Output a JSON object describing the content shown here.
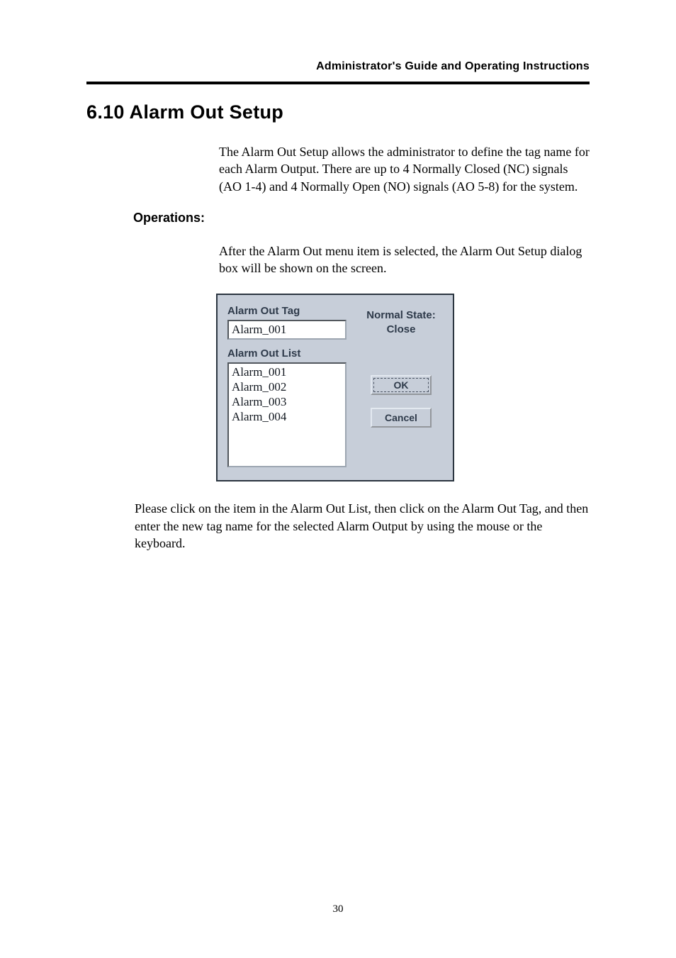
{
  "header": "Administrator's Guide and Operating Instructions",
  "section_title": "6.10 Alarm Out Setup",
  "intro": "The Alarm Out Setup allows the administrator to define the tag name for each Alarm Output.   There are up to 4 Normally Closed (NC) signals (AO 1-4) and 4 Normally Open (NO) signals (AO 5-8) for the system.",
  "operations_heading": "Operations:",
  "operations_text": "After the Alarm Out menu item is selected, the Alarm Out Setup dialog box will be shown on the screen.",
  "dialog": {
    "tag_label": "Alarm Out Tag",
    "tag_value": "Alarm_001",
    "list_label": "Alarm Out List",
    "list_items": [
      "Alarm_001",
      "Alarm_002",
      "Alarm_003",
      "Alarm_004"
    ],
    "normal_state_label": "Normal State:",
    "normal_state_value": "Close",
    "ok_label": "OK",
    "cancel_label": "Cancel"
  },
  "instruction": "Please click on the item in the Alarm Out List, then click on the Alarm Out Tag, and then enter the new tag name for the selected Alarm Output by using the mouse or the keyboard.",
  "page_number": "30"
}
